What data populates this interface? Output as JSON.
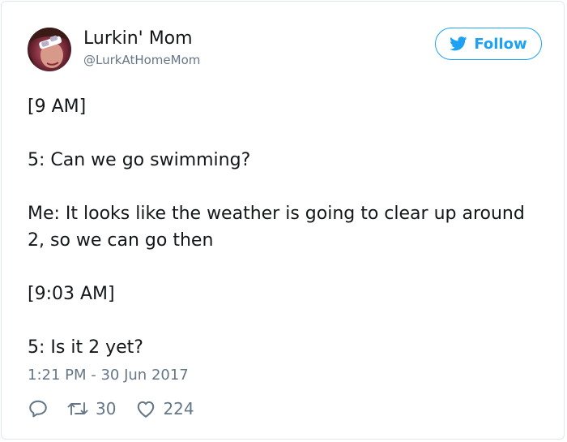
{
  "user": {
    "display_name": "Lurkin' Mom",
    "handle": "@LurkAtHomeMom"
  },
  "follow_button": {
    "label": "Follow"
  },
  "tweet": {
    "text": "[9 AM]\n\n5: Can we go swimming?\n\nMe: It looks like the weather is going to clear up around 2, so we can go then\n\n[9:03 AM]\n\n5: Is it 2 yet?",
    "timestamp": "1:21 PM - 30 Jun 2017"
  },
  "actions": {
    "retweet_count": "30",
    "like_count": "224"
  },
  "colors": {
    "accent": "#1da1f2",
    "text": "#14171a",
    "secondary": "#657786",
    "border": "#e1e8ed"
  },
  "icons": {
    "bird": "twitter-bird-icon",
    "reply": "reply-icon",
    "retweet": "retweet-icon",
    "like": "heart-icon"
  }
}
